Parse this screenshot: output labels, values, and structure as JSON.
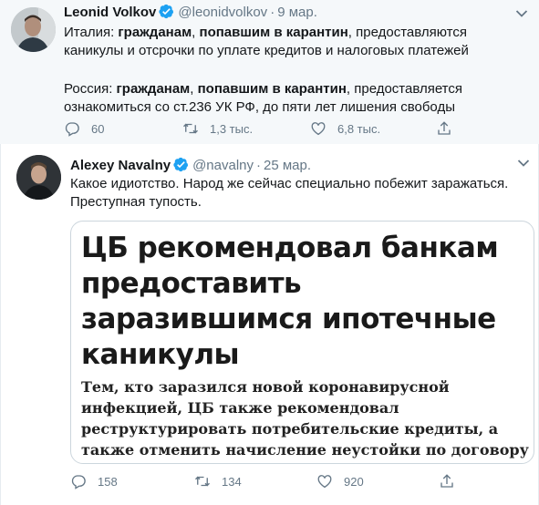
{
  "tweets": [
    {
      "name": "Leonid Volkov",
      "handle": "@leonidvolkov",
      "date": "9 мар.",
      "paragraphs": [
        [
          {
            "t": "Италия: ",
            "b": false
          },
          {
            "t": "гражданам",
            "b": true
          },
          {
            "t": ", ",
            "b": false
          },
          {
            "t": "попавшим в карантин",
            "b": true
          },
          {
            "t": ", предоставляются каникулы и отсрочки по уплате кредитов и налоговых платежей",
            "b": false
          }
        ],
        [
          {
            "t": "Россия: ",
            "b": false
          },
          {
            "t": "гражданам",
            "b": true
          },
          {
            "t": ", ",
            "b": false
          },
          {
            "t": "попавшим в карантин",
            "b": true
          },
          {
            "t": ", предоставляется ознакомиться со ст.236 УК РФ, до пяти лет лишения свободы",
            "b": false
          }
        ]
      ],
      "stats": {
        "replies": "60",
        "retweets": "1,3 тыс.",
        "likes": "6,8 тыс."
      }
    },
    {
      "name": "Alexey Navalny",
      "handle": "@navalny",
      "date": "25 мар.",
      "paragraphs": [
        [
          {
            "t": "Какое идиотство. Народ же сейчас специально побежит заражаться. Преступная тупость.",
            "b": false
          }
        ]
      ],
      "card": {
        "headline": "ЦБ рекомендовал банкам предоставить заразившимся ипотечные каникулы",
        "subtext": "Тем, кто заразился новой коронавирусной инфекцией, ЦБ также рекомендовал реструктурировать потребительские кредиты, а также отменить начисление неустойки по договору"
      },
      "stats": {
        "replies": "158",
        "retweets": "134",
        "likes": "920"
      }
    }
  ],
  "colors": {
    "verified": "#1da1f2",
    "muted": "#657786",
    "text": "#14171a",
    "highlight_bg": "#f5f8fa",
    "border": "#e6ecf0"
  },
  "icons": [
    "verified-badge-icon",
    "chevron-down-icon",
    "reply-icon",
    "retweet-icon",
    "like-icon",
    "share-icon"
  ]
}
